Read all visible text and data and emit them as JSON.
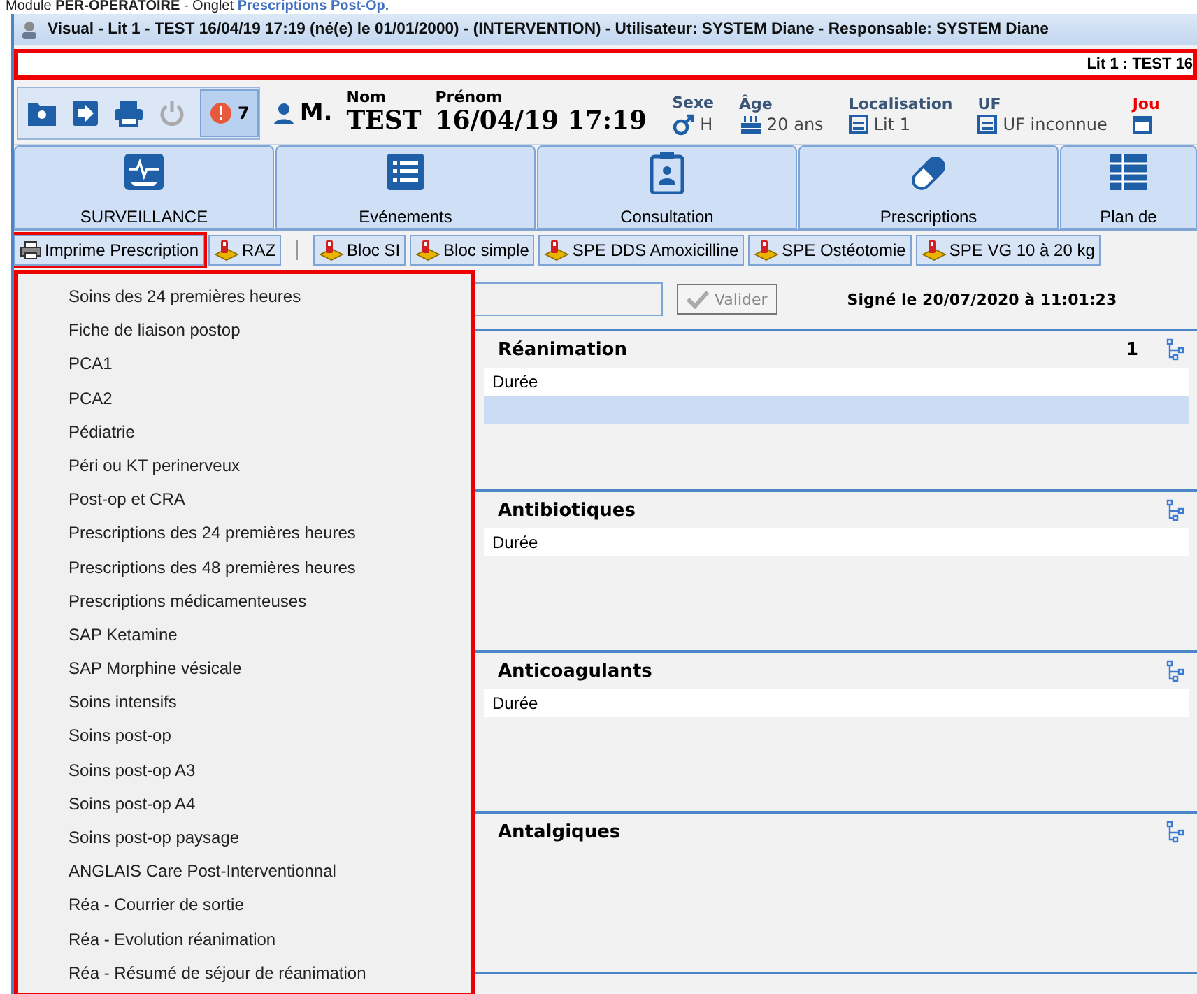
{
  "caption": {
    "prefix": "Module ",
    "module": "PER-OPERATOIRE",
    "middle": " - Onglet ",
    "tab": "Prescriptions Post-Op."
  },
  "window": {
    "title": "Visual - Lit 1 - TEST  16/04/19 17:19 (né(e) le 01/01/2000) - (INTERVENTION) - Utilisateur: SYSTEM Diane - Responsable: SYSTEM Diane"
  },
  "banner": {
    "text": "Lit 1 : TEST 16"
  },
  "patient": {
    "alert_count": "7",
    "civility": "M.",
    "fields": [
      {
        "kind": "name",
        "label": "Nom",
        "value": "TEST"
      },
      {
        "kind": "name",
        "label": "Prénom",
        "value": "16/04/19 17:19"
      },
      {
        "kind": "info",
        "label": "Sexe",
        "value": "H"
      },
      {
        "kind": "info",
        "label": "Âge",
        "value": "20 ans"
      },
      {
        "kind": "info",
        "label": "Localisation",
        "value": "Lit 1"
      },
      {
        "kind": "info",
        "label": "UF",
        "value": "UF inconnue"
      },
      {
        "kind": "date",
        "label": "Jou"
      }
    ]
  },
  "tabs": [
    {
      "label": "SURVEILLANCE",
      "selected": false
    },
    {
      "label": "Evénements",
      "selected": false
    },
    {
      "label": "Consultation",
      "selected": false
    },
    {
      "label": "Prescriptions",
      "selected": false
    },
    {
      "label": "Plan de",
      "selected": false
    }
  ],
  "toolbar": [
    {
      "kind": "print",
      "label": "Imprime Prescription",
      "highlighted": true
    },
    {
      "kind": "protocol",
      "label": "RAZ",
      "highlighted": false
    },
    {
      "kind": "separator"
    },
    {
      "kind": "protocol",
      "label": "Bloc SI",
      "highlighted": false
    },
    {
      "kind": "protocol",
      "label": "Bloc simple",
      "highlighted": false
    },
    {
      "kind": "protocol",
      "label": "SPE DDS Amoxicilline",
      "highlighted": false
    },
    {
      "kind": "protocol",
      "label": "SPE Ostéotomie",
      "highlighted": false
    },
    {
      "kind": "protocol",
      "label": "SPE VG 10 à 20 kg",
      "highlighted": false
    }
  ],
  "menu": {
    "highlighted": true,
    "items": [
      "Soins des 24 premières heures",
      "Fiche de liaison postop",
      "PCA1",
      "PCA2",
      "Pédiatrie",
      "Péri ou KT perinerveux",
      "Post-op et CRA",
      "Prescriptions des 24 premières heures",
      "Prescriptions des 48 premières heures",
      "Prescriptions médicamenteuses",
      "SAP Ketamine",
      "SAP Morphine vésicale",
      "Soins intensifs",
      "Soins post-op",
      "Soins post-op A3",
      "Soins post-op A4",
      "Soins post-op paysage",
      "ANGLAIS Care Post-Interventionnal",
      "Réa - Courrier de sortie",
      "Réa - Evolution réanimation",
      "Réa - Résumé de séjour de réanimation"
    ]
  },
  "validate": {
    "button": "Valider",
    "disabled": true,
    "signed": "Signé le 20/07/2020 à 11:01:23"
  },
  "sections": [
    {
      "title": "Réanimation",
      "count": "1",
      "rows": [
        {
          "text": "Durée",
          "selected": false
        },
        {
          "text": "",
          "selected": true
        }
      ]
    },
    {
      "title": "Antibiotiques",
      "rows": [
        {
          "text": "Durée",
          "selected": false
        }
      ]
    },
    {
      "title": "Anticoagulants",
      "rows": [
        {
          "text": "Durée",
          "selected": false
        }
      ]
    },
    {
      "title": "Antalgiques"
    }
  ]
}
